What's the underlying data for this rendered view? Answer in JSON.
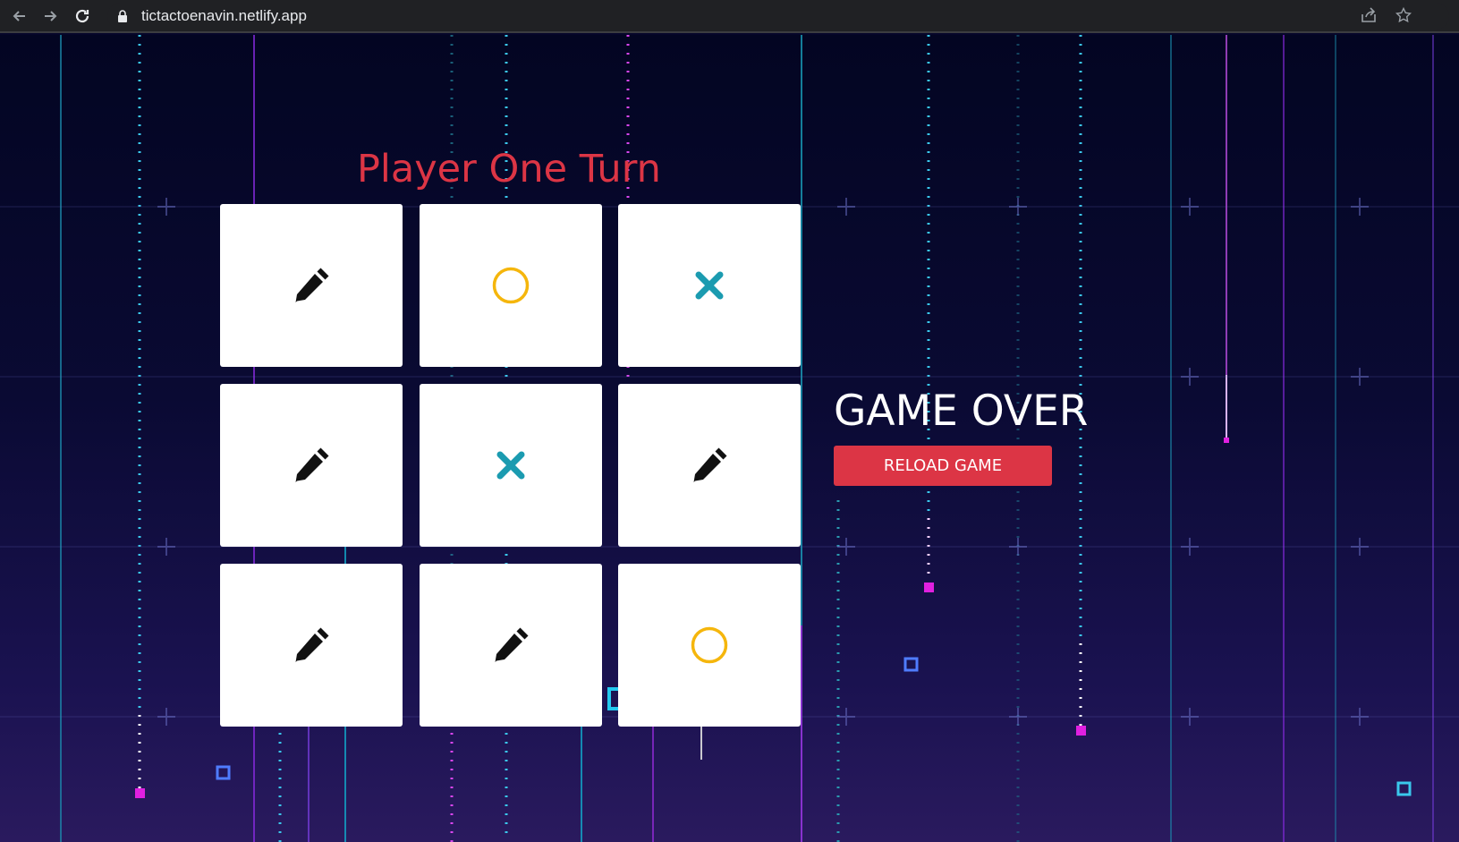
{
  "browser": {
    "url": "tictactoenavin.netlify.app",
    "icons": {
      "back": "arrow-left-icon",
      "forward": "arrow-right-icon",
      "reload": "reload-icon",
      "lock": "lock-icon",
      "share": "share-icon",
      "star": "star-icon"
    }
  },
  "game": {
    "turn_label": "Player One Turn",
    "board": [
      [
        "empty",
        "O",
        "X"
      ],
      [
        "empty",
        "X",
        "empty"
      ],
      [
        "empty",
        "empty",
        "O"
      ]
    ],
    "status_text": "GAME OVER",
    "reload_label": "RELOAD GAME"
  },
  "colors": {
    "accent_red": "#dc3545",
    "x_color": "#1b9bb0",
    "o_color": "#f5b60c",
    "empty_icon": "#111111",
    "background": "#06062a"
  }
}
